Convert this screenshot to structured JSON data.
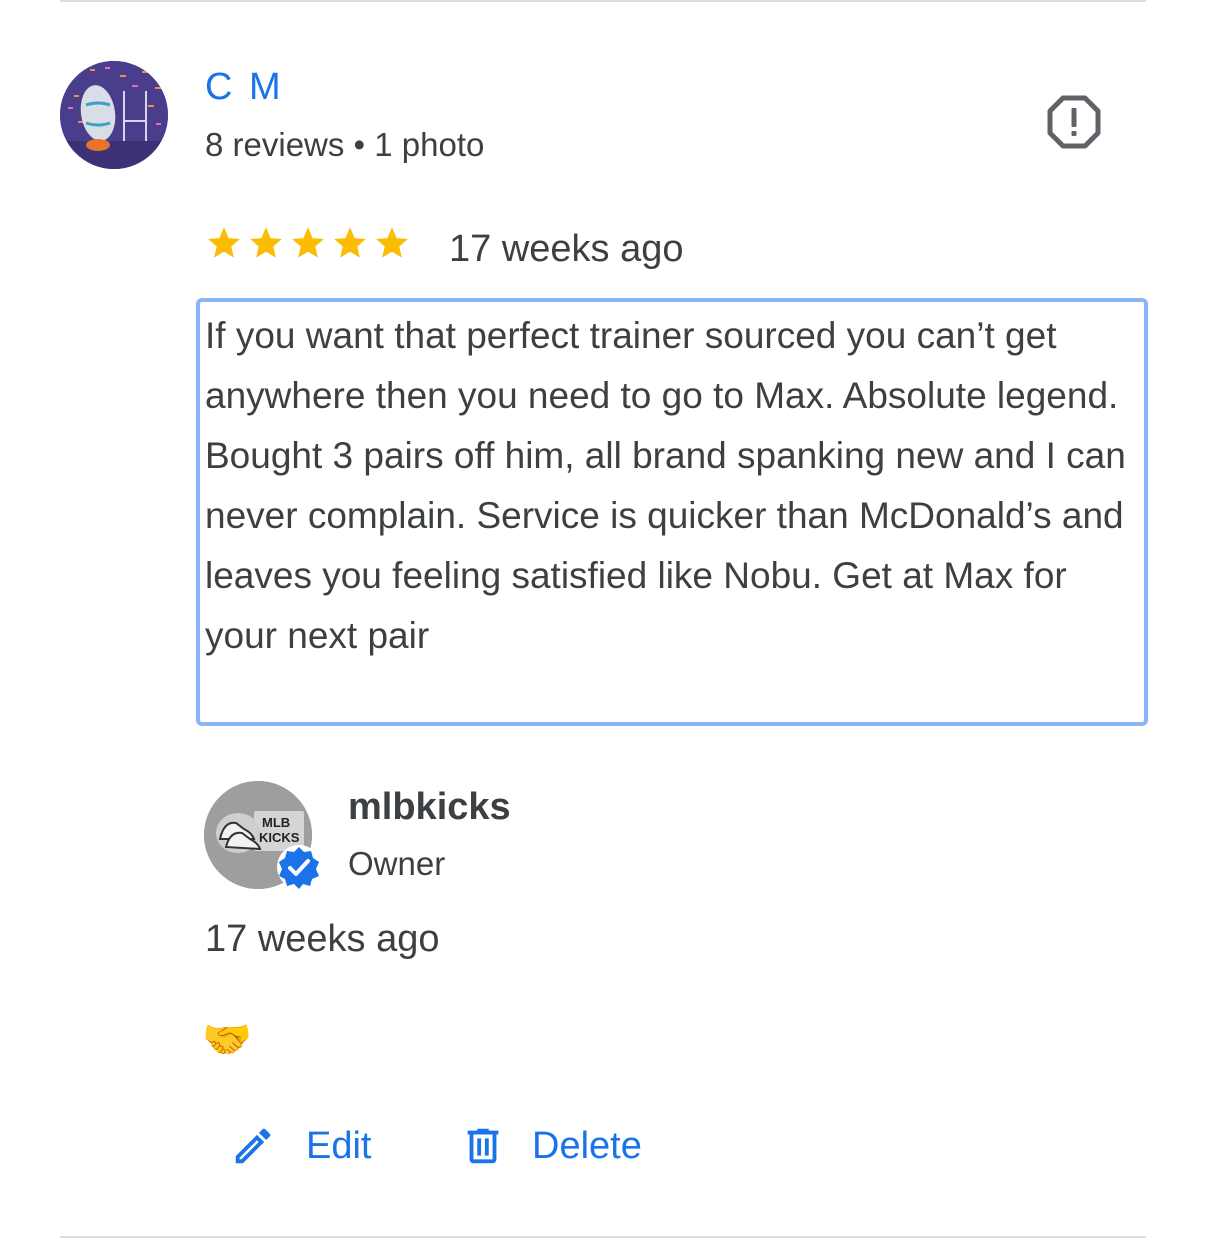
{
  "reviewer": {
    "name": "C M",
    "meta": "8 reviews • 1 photo",
    "avatar_icon": "rugby-ball-avatar"
  },
  "review": {
    "rating": 5,
    "rating_max": 5,
    "time": "17 weeks ago",
    "text": "If you want that perfect trainer sourced you can’t get anywhere then you need to go to Max. Absolute legend. Bought 3 pairs off him, all brand spanking new and I can never complain. Service is quicker than McDonald’s and leaves you feeling satisfied like Nobu. Get at Max for your next pair"
  },
  "owner": {
    "name": "mlbkicks",
    "role": "Owner",
    "time": "17 weeks ago",
    "reply": "🤝",
    "avatar_text_1": "MLB",
    "avatar_text_2": "KICKS"
  },
  "actions": {
    "edit_label": "Edit",
    "delete_label": "Delete"
  },
  "colors": {
    "accent": "#1a73e8",
    "star": "#fbbc04",
    "highlight_border": "#8ab4f8",
    "text": "#3c4043"
  }
}
